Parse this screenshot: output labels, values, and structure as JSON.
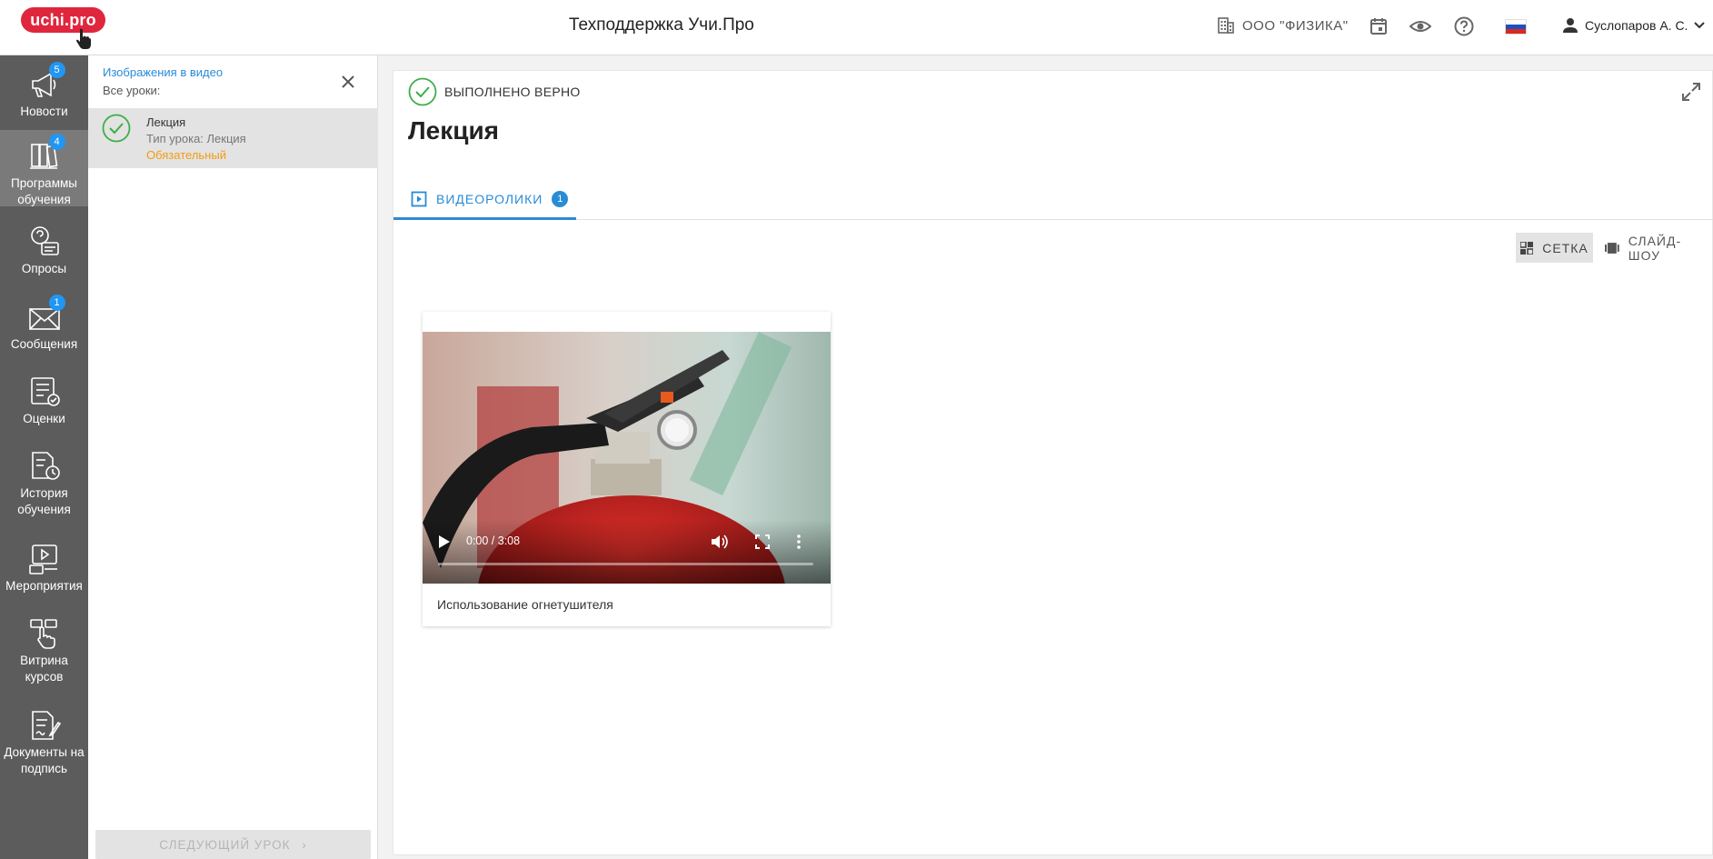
{
  "header": {
    "logo": "uchi.pro",
    "title": "Техподдержка Учи.Про",
    "org": "ООО \"ФИЗИКА\"",
    "user": "Суслопаров А. С.",
    "icons": [
      "building-icon",
      "calendar-icon",
      "eye-icon",
      "help-icon",
      "flag-ru-icon",
      "person-icon",
      "chevron-down-icon"
    ]
  },
  "nav": {
    "items": [
      {
        "label": "Новости",
        "badge": "5",
        "icon": "megaphone-icon"
      },
      {
        "label": "Программы обучения",
        "badge": "4",
        "icon": "books-icon"
      },
      {
        "label": "Опросы",
        "badge": "",
        "icon": "survey-icon"
      },
      {
        "label": "Сообщения",
        "badge": "1",
        "icon": "mail-icon"
      },
      {
        "label": "Оценки",
        "badge": "",
        "icon": "grades-icon"
      },
      {
        "label": "История обучения",
        "badge": "",
        "icon": "history-icon"
      },
      {
        "label": "Мероприятия",
        "badge": "",
        "icon": "events-icon"
      },
      {
        "label": "Витрина курсов",
        "badge": "",
        "icon": "showcase-icon"
      },
      {
        "label": "Документы на подпись",
        "badge": "",
        "icon": "documents-icon"
      }
    ]
  },
  "lesson_panel": {
    "course": "Изображения в видео",
    "all_lessons": "Все уроки:",
    "lesson": {
      "name": "Лекция",
      "type": "Тип урока: Лекция",
      "required": "Обязательный"
    },
    "next_button": "СЛЕДУЮЩИЙ УРОК"
  },
  "main": {
    "status": "ВЫПОЛНЕНО ВЕРНО",
    "title": "Лекция",
    "tab": {
      "label": "ВИДЕОРОЛИКИ",
      "count": "1"
    },
    "view_grid": "СЕТКА",
    "view_slideshow": "СЛАЙД-ШОУ",
    "video": {
      "time": "0:00 / 3:08",
      "caption": "Использование огнетушителя",
      "progress": 0
    }
  },
  "colors": {
    "brand": "#e0263d",
    "accent": "#2a8bd6",
    "success": "#3fae49",
    "required": "#f39c12",
    "nav_bg": "#5c5c5c"
  }
}
